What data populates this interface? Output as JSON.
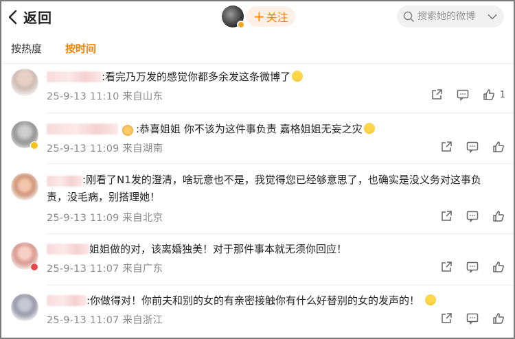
{
  "header": {
    "back_label": "返回",
    "follow_label": "关注",
    "follow_plus": "+",
    "search_placeholder": "搜索她的微博"
  },
  "tabs": [
    {
      "label": "按热度",
      "active": false
    },
    {
      "label": "按时间",
      "active": true
    }
  ],
  "accent_color": "#ff8200",
  "comments": [
    {
      "text": ":看完乃万发的感觉你都多余发这条微博了",
      "emoji": "laugh-cry-emoji",
      "date": "25-9-13 11:10",
      "location": "来自山东",
      "likes": "1"
    },
    {
      "text": ":恭喜姐姐 你不该为这件事负责 嘉格姐姐无妄之灾",
      "emoji": "tears-emoji",
      "date": "25-9-13 11:09",
      "location": "来自湖南",
      "likes": ""
    },
    {
      "text_line1": ":刚看了N1发的澄清，啥玩意也不是，我觉得您已经够意思了，也确实是没义务对这事负",
      "text_line2": "责，没毛病，别搭理她！",
      "date": "25-9-13 11:09",
      "location": "来自北京",
      "likes": ""
    },
    {
      "text": "姐姐做的对，该离婚独美！对于那件事本就无须你回应！",
      "date": "25-9-13 11:07",
      "location": "来自广东",
      "likes": ""
    },
    {
      "text": ":你做得对！你前夫和别的女的有亲密接触你有什么好替别的女的发声的！",
      "emoji": "facepalm-emoji",
      "date": "25-9-13 11:07",
      "location": "来自浙江",
      "likes": ""
    }
  ]
}
